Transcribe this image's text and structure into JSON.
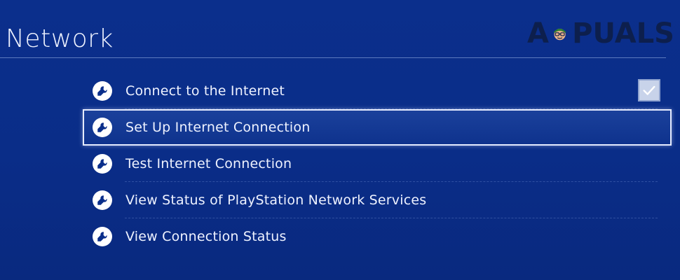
{
  "header": {
    "title": "Network"
  },
  "watermark": {
    "text_left": "A",
    "text_right": "PUALS",
    "mascot_icon": "appuals-mascot-icon"
  },
  "menu": {
    "items": [
      {
        "label": "Connect to the Internet",
        "icon": "wrench-icon",
        "checked": true,
        "selected": false
      },
      {
        "label": "Set Up Internet Connection",
        "icon": "wrench-icon",
        "selected": true
      },
      {
        "label": "Test Internet Connection",
        "icon": "wrench-icon",
        "selected": false
      },
      {
        "label": "View Status of PlayStation Network Services",
        "icon": "wrench-icon",
        "selected": false
      },
      {
        "label": "View Connection Status",
        "icon": "wrench-icon",
        "selected": false
      }
    ]
  },
  "colors": {
    "background": "#0a2e8a",
    "text": "#eef2ff",
    "selection_border": "#e6ecff",
    "checkbox_fill": "#c8d3ea"
  }
}
